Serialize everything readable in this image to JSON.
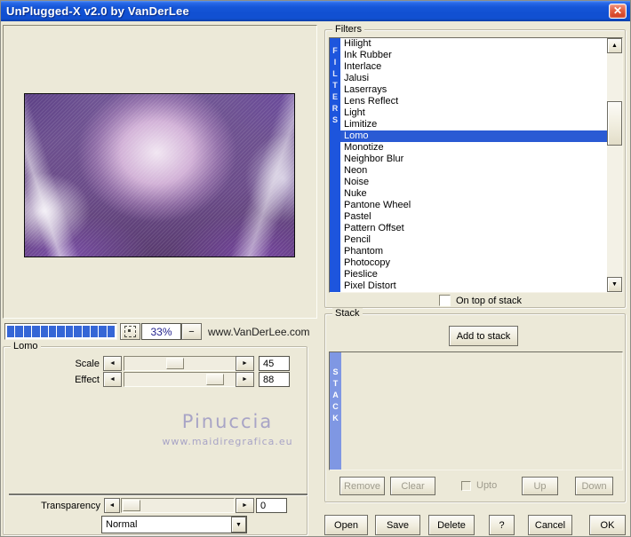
{
  "window": {
    "title": "UnPlugged-X v2.0 by VanDerLee",
    "close_label": "✕"
  },
  "preview": {
    "progress_segments": 13,
    "zoom_level": "33%",
    "zoom_out_label": "−",
    "website": "www.VanDerLee.com"
  },
  "filter_params": {
    "group_label": "Lomo",
    "sliders": [
      {
        "label": "Scale",
        "value": "45",
        "percent": 45
      },
      {
        "label": "Effect",
        "value": "88",
        "percent": 88
      }
    ]
  },
  "watermark": {
    "name": "Pinuccia",
    "site": "www.maidiregrafica.eu"
  },
  "transparency": {
    "label": "Transparency",
    "value": "0",
    "percent": 0
  },
  "blend_mode": {
    "value": "Normal"
  },
  "filters": {
    "group_label": "Filters",
    "tab_label": "FILTERS",
    "selected": "Lomo",
    "on_top_label": "On top of stack",
    "items": [
      "Hilight",
      "Ink Rubber",
      "Interlace",
      "Jalusi",
      "Laserrays",
      "Lens Reflect",
      "Light",
      "Limitize",
      "Lomo",
      "Monotize",
      "Neighbor Blur",
      "Neon",
      "Noise",
      "Nuke",
      "Pantone Wheel",
      "Pastel",
      "Pattern Offset",
      "Pencil",
      "Phantom",
      "Photocopy",
      "Pieslice",
      "Pixel Distort"
    ]
  },
  "stack": {
    "group_label": "Stack",
    "tab_label": "STACK",
    "add_button": "Add to stack",
    "remove_button": "Remove",
    "clear_button": "Clear",
    "upto_label": "Upto",
    "up_button": "Up",
    "down_button": "Down"
  },
  "footer": {
    "buttons": [
      "Open",
      "Save",
      "Delete",
      "?",
      "Cancel",
      "OK"
    ]
  },
  "colors": {
    "accent_blue": "#2a5ad4",
    "filters_strip": "#1d55dd",
    "stack_strip": "#7f97e3",
    "titlebar_blue": "#1150d2",
    "close_red": "#cf3a1e",
    "dialog_bg": "#ece9d8"
  }
}
